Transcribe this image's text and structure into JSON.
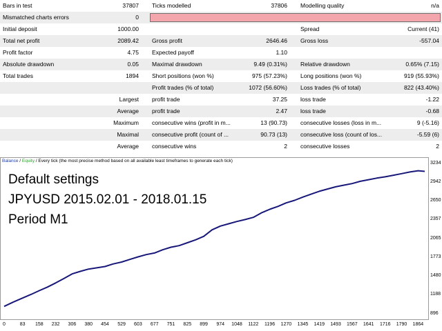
{
  "report": {
    "rows": [
      {
        "cells": [
          "Bars in test",
          "37807",
          "Ticks modelled",
          "37806",
          "Modelling quality",
          "n/a"
        ]
      },
      {
        "cells": [
          "Mismatched charts errors",
          "0",
          "",
          "",
          "",
          ""
        ],
        "quality_bar": true
      },
      {
        "cells": [
          "Initial deposit",
          "1000.00",
          "",
          "",
          "Spread",
          "Current (41)"
        ]
      },
      {
        "cells": [
          "Total net profit",
          "2089.42",
          "Gross profit",
          "2646.46",
          "Gross loss",
          "-557.04"
        ]
      },
      {
        "cells": [
          "Profit factor",
          "4.75",
          "Expected payoff",
          "1.10",
          "",
          ""
        ]
      },
      {
        "cells": [
          "Absolute drawdown",
          "0.05",
          "Maximal drawdown",
          "9.49 (0.31%)",
          "Relative drawdown",
          "0.65% (7.15)"
        ]
      },
      {
        "cells": [
          "Total trades",
          "1894",
          "Short positions (won %)",
          "975 (57.23%)",
          "Long positions (won %)",
          "919 (55.93%)"
        ]
      },
      {
        "cells": [
          "",
          "",
          "Profit trades (% of total)",
          "1072 (56.60%)",
          "Loss trades (% of total)",
          "822 (43.40%)"
        ]
      },
      {
        "cells": [
          "",
          "Largest",
          "profit trade",
          "37.25",
          "loss trade",
          "-1.22"
        ]
      },
      {
        "cells": [
          "",
          "Average",
          "profit trade",
          "2.47",
          "loss trade",
          "-0.68"
        ]
      },
      {
        "cells": [
          "",
          "Maximum",
          "consecutive wins (profit in m...",
          "13 (90.73)",
          "consecutive losses (loss in m...",
          "9 (-5.16)"
        ]
      },
      {
        "cells": [
          "",
          "Maximal",
          "consecutive profit (count of ...",
          "90.73 (13)",
          "consecutive loss (count of los...",
          "-5.59 (6)"
        ]
      },
      {
        "cells": [
          "",
          "Average",
          "consecutive wins",
          "2",
          "consecutive losses",
          "2"
        ]
      }
    ]
  },
  "chart": {
    "legend": {
      "balance": "Balance",
      "sep": " / ",
      "equity": "Equity",
      "rest": " / Every tick (the most precise method based on all available least timeframes to generate each tick)"
    },
    "overlay": [
      "Default settings",
      "JPYUSD 2015.02.01 - 2018.01.15",
      "Period M1"
    ],
    "line_color": "#17177a",
    "bar_color": "#f4a6ad"
  },
  "chart_data": {
    "type": "line",
    "title": "",
    "xlabel": "",
    "ylabel": "",
    "x_ticks": [
      "0",
      "83",
      "158",
      "232",
      "306",
      "380",
      "454",
      "529",
      "603",
      "677",
      "751",
      "825",
      "899",
      "974",
      "1048",
      "1122",
      "1196",
      "1270",
      "1345",
      "1419",
      "1493",
      "1567",
      "1641",
      "1716",
      "1790",
      "1864"
    ],
    "y_ticks": [
      "3234",
      "2942",
      "2650",
      "2357",
      "2065",
      "1773",
      "1480",
      "1188",
      "896"
    ],
    "xlim": [
      0,
      1894
    ],
    "ylim": [
      896,
      3234
    ],
    "series": [
      {
        "x": [
          0,
          40,
          83,
          120,
          158,
          195,
          232,
          270,
          306,
          343,
          380,
          417,
          454,
          490,
          529,
          566,
          603,
          640,
          677,
          714,
          751,
          788,
          825,
          862,
          899,
          936,
          974,
          1011,
          1048,
          1085,
          1122,
          1159,
          1196,
          1233,
          1270,
          1308,
          1345,
          1382,
          1419,
          1456,
          1493,
          1530,
          1567,
          1604,
          1641,
          1678,
          1716,
          1753,
          1790,
          1827,
          1864,
          1894
        ],
        "values": [
          1000,
          1065,
          1130,
          1185,
          1245,
          1300,
          1365,
          1435,
          1505,
          1545,
          1580,
          1600,
          1620,
          1660,
          1690,
          1730,
          1770,
          1805,
          1830,
          1880,
          1920,
          1945,
          1990,
          2035,
          2090,
          2190,
          2250,
          2285,
          2320,
          2350,
          2385,
          2455,
          2510,
          2555,
          2610,
          2650,
          2700,
          2745,
          2790,
          2825,
          2860,
          2885,
          2910,
          2945,
          2970,
          2995,
          3015,
          3040,
          3065,
          3090,
          3110,
          3100
        ]
      }
    ]
  }
}
